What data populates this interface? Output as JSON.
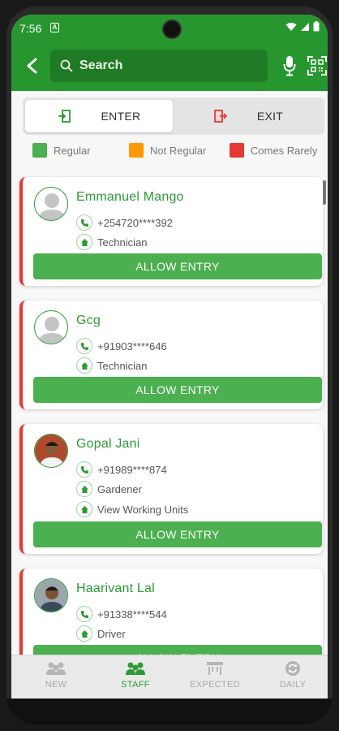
{
  "status_bar": {
    "time": "7:56",
    "notif_glyph": "A"
  },
  "app_bar": {
    "search_placeholder": "Search"
  },
  "toggle": {
    "enter_label": "ENTER",
    "exit_label": "EXIT"
  },
  "legend": [
    {
      "label": "Regular",
      "color": "#4caf50"
    },
    {
      "label": "Not Regular",
      "color": "#ff9800"
    },
    {
      "label": "Comes Rarely",
      "color": "#e53935"
    }
  ],
  "staff": [
    {
      "name": "Emmanuel Mango",
      "phone": "+254720****392",
      "role": "Technician",
      "avatar": "placeholder"
    },
    {
      "name": "Gcg",
      "phone": "+91903****646",
      "role": "Technician",
      "avatar": "placeholder"
    },
    {
      "name": "Gopal Jani",
      "phone": "+91989****874",
      "role": "Gardener",
      "extra": "View Working Units",
      "avatar": "photo"
    },
    {
      "name": "Haarivant Lal",
      "phone": "+91338****544",
      "role": "Driver",
      "avatar": "photo"
    }
  ],
  "allow_button_label": "ALLOW ENTRY",
  "bottom_nav": [
    {
      "label": "NEW",
      "icon": "people-icon",
      "active": false
    },
    {
      "label": "STAFF",
      "icon": "staff-icon",
      "active": true
    },
    {
      "label": "EXPECTED",
      "icon": "expected-icon",
      "active": false
    },
    {
      "label": "DAILY",
      "icon": "refresh-icon",
      "active": false
    }
  ]
}
